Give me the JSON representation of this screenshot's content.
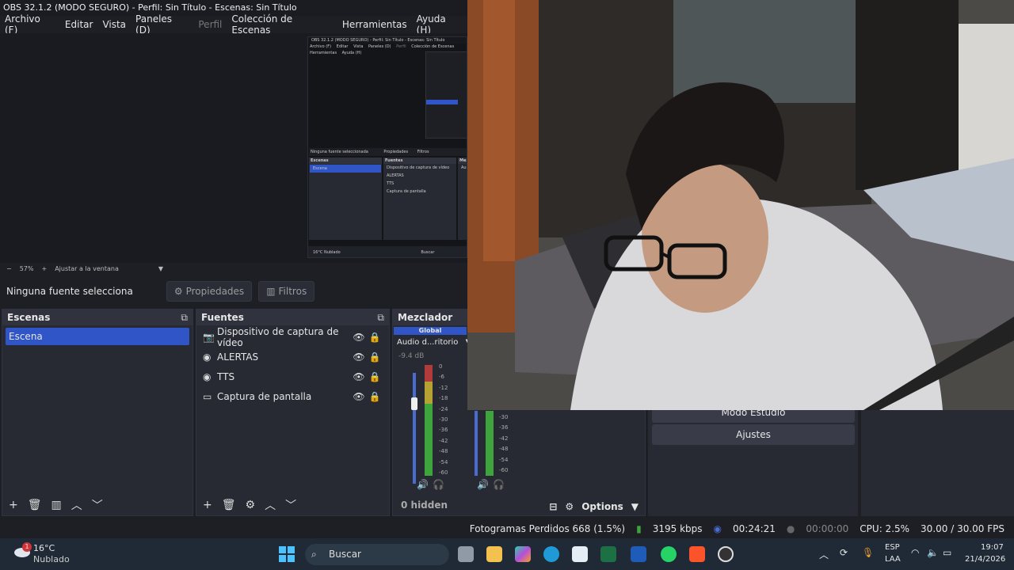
{
  "window": {
    "title": "OBS 32.1.2 (MODO SEGURO) - Perfil: Sin Título - Escenas: Sin Título"
  },
  "menu": [
    "Archivo (F)",
    "Editar",
    "Vista",
    "Paneles (D)",
    "Perfil",
    "Colección de Escenas",
    "Herramientas",
    "Ayuda (H)"
  ],
  "nested_preview": {
    "title": "OBS 32.1.2 (MODO SEGURO) - Perfil: Sin Título - Escenas: Sin Título",
    "menu": [
      "Archivo (F)",
      "Editar",
      "Vista",
      "Paneles (D)",
      "Perfil",
      "Colección de Escenas",
      "Herramientas",
      "Ayuda (H)"
    ],
    "no_source": "Ninguna fuente seleccionada",
    "props": "Propiedades",
    "filters": "Filtros",
    "scenes_header": "Escenas",
    "scene": "Escena",
    "sources_header": "Fuentes",
    "sources": [
      "Dispositivo de captura de vídeo",
      "ALERTAS",
      "TTS",
      "Captura de pantalla"
    ],
    "mixer_header": "Mez",
    "audio_label": "Audi",
    "weather_temp": "16°C",
    "weather_text": "Nublado",
    "search": "Buscar"
  },
  "zoom": {
    "minus": "−",
    "value": "57%",
    "plus": "+",
    "fit": "Ajustar a la ventana"
  },
  "source_toolbar": {
    "label": "Ninguna fuente selecciona",
    "properties": "Propiedades",
    "filters": "Filtros"
  },
  "scenes": {
    "header": "Escenas",
    "items": [
      "Escena"
    ]
  },
  "sources": {
    "header": "Fuentes",
    "items": [
      {
        "name": "Dispositivo de captura de vídeo",
        "icon": "camera-icon"
      },
      {
        "name": "ALERTAS",
        "icon": "globe-icon"
      },
      {
        "name": "TTS",
        "icon": "globe-icon"
      },
      {
        "name": "Captura de pantalla",
        "icon": "monitor-icon"
      }
    ]
  },
  "mixer": {
    "header": "Mezclador de au",
    "global": "Global",
    "device": "Audio d...ritorio",
    "db": "-9.4 dB",
    "scale": [
      "0",
      "-6",
      "-12",
      "-18",
      "-24",
      "-30",
      "-36",
      "-42",
      "-48",
      "-54",
      "-60"
    ],
    "scale2": [
      "-30",
      "-36",
      "-42",
      "-48",
      "-54",
      "-60"
    ],
    "hidden": "0 hidden",
    "options": "Options"
  },
  "controls": {
    "studio": "Modo Estudio",
    "settings": "Ajustes"
  },
  "status": {
    "dropped": "Fotogramas Perdidos 668 (1.5%)",
    "bitrate": "3195 kbps",
    "stream_time": "00:24:21",
    "rec_time": "00:00:00",
    "cpu": "CPU: 2.5%",
    "fps": "30.00 / 30.00 FPS"
  },
  "taskbar": {
    "weather_temp": "16°C",
    "weather_text": "Nublado",
    "weather_badge": "1",
    "search": "Buscar",
    "lang": "ESP",
    "layout": "LAA",
    "time": "19:07",
    "date": "21/4/2026"
  },
  "colors": {
    "accent": "#2f55c7",
    "dock_bg": "#272a33",
    "meter_green": "#3da53b",
    "meter_yellow": "#b6a232",
    "meter_red": "#b23a3a"
  }
}
